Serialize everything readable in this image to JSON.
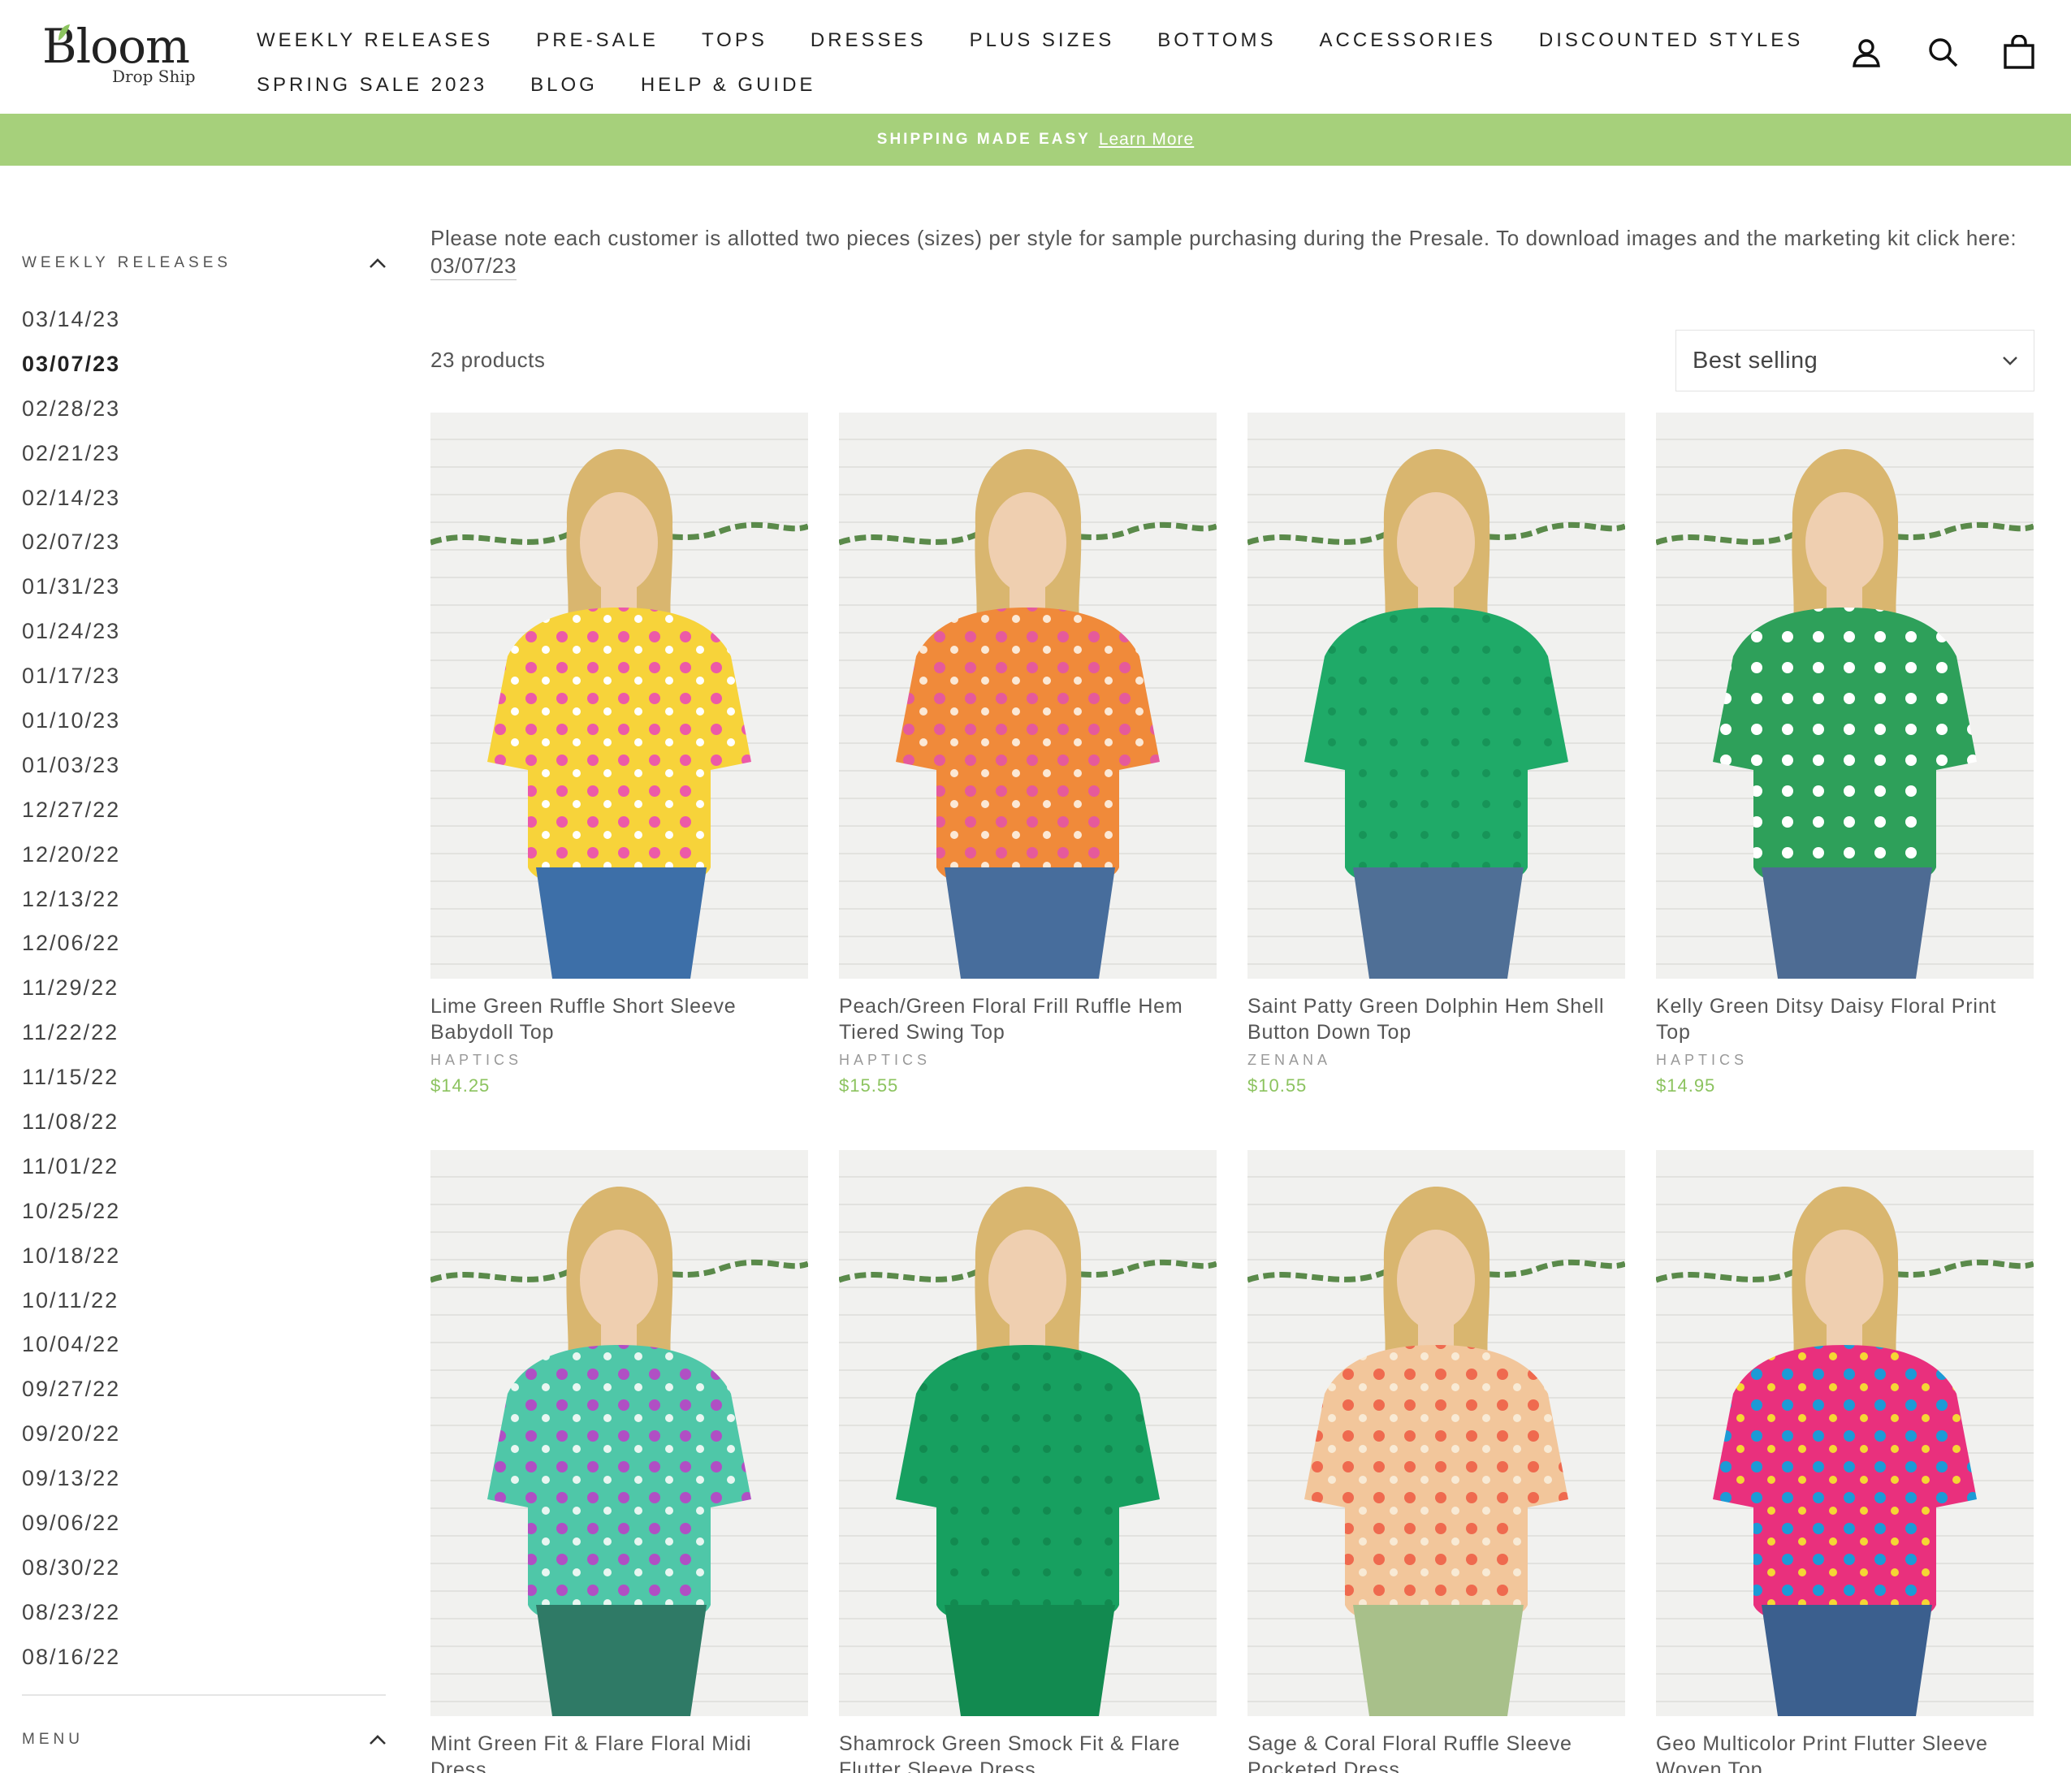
{
  "brand": {
    "name": "Bloom",
    "tagline": "Drop Ship"
  },
  "nav": {
    "row1": [
      "WEEKLY RELEASES",
      "PRE-SALE",
      "TOPS",
      "DRESSES",
      "PLUS SIZES",
      "BOTTOMS",
      "ACCESSORIES",
      "DISCOUNTED STYLES"
    ],
    "row2": [
      "SPRING SALE 2023",
      "BLOG",
      "HELP & GUIDE"
    ]
  },
  "header_icons": [
    "account-icon",
    "search-icon",
    "cart-icon"
  ],
  "announcement": {
    "text": "SHIPPING MADE EASY",
    "link": "Learn More"
  },
  "sidebar": {
    "section_label": "WEEKLY RELEASES",
    "dates": [
      "03/14/23",
      "03/07/23",
      "02/28/23",
      "02/21/23",
      "02/14/23",
      "02/07/23",
      "01/31/23",
      "01/24/23",
      "01/17/23",
      "01/10/23",
      "01/03/23",
      "12/27/22",
      "12/20/22",
      "12/13/22",
      "12/06/22",
      "11/29/22",
      "11/22/22",
      "11/15/22",
      "11/08/22",
      "11/01/22",
      "10/25/22",
      "10/18/22",
      "10/11/22",
      "10/04/22",
      "09/27/22",
      "09/20/22",
      "09/13/22",
      "09/06/22",
      "08/30/22",
      "08/23/22",
      "08/16/22"
    ],
    "active_date": "03/07/23",
    "menu_label": "MENU"
  },
  "main": {
    "note": "Please note each customer is allotted two pieces (sizes) per style for sample purchasing during the Presale. To download images and the marketing kit click here:",
    "note_link": "03/07/23",
    "product_count": "23 products",
    "sort_value": "Best selling"
  },
  "products": [
    {
      "title": "Lime Green Ruffle Short Sleeve Babydoll Top",
      "vendor": "HAPTICS",
      "price": "$14.25",
      "colors": [
        "#f7d33a",
        "#ec5aa8",
        "#ffffff",
        "#3d6fa8"
      ]
    },
    {
      "title": "Peach/Green Floral Frill Ruffle Hem Tiered Swing Top",
      "vendor": "HAPTICS",
      "price": "$15.55",
      "colors": [
        "#f08a3a",
        "#e55a9b",
        "#fbe8d5",
        "#476d9c"
      ]
    },
    {
      "title": "Saint Patty Green Dolphin Hem Shell Button Down Top",
      "vendor": "ZENANA",
      "price": "$10.55",
      "colors": [
        "#1faa68",
        "#1faa68",
        "#179458",
        "#4f6f96"
      ]
    },
    {
      "title": "Kelly Green Ditsy Daisy Floral Print Top",
      "vendor": "HAPTICS",
      "price": "$14.95",
      "colors": [
        "#2ea05a",
        "#ffffff",
        "#2ea05a",
        "#4d6b93"
      ]
    },
    {
      "title": "Mint Green Fit & Flare Floral Midi Dress",
      "vendor": "",
      "price": "",
      "colors": [
        "#4fc7a8",
        "#b04fc4",
        "#e8f6f1",
        "#2f7a66"
      ]
    },
    {
      "title": "Shamrock Green Smock Fit & Flare Flutter Sleeve Dress",
      "vendor": "",
      "price": "",
      "colors": [
        "#17a060",
        "#17a060",
        "#128a50",
        "#128a50"
      ]
    },
    {
      "title": "Sage & Coral Floral Ruffle Sleeve Pocketed Dress",
      "vendor": "",
      "price": "",
      "colors": [
        "#f2c69b",
        "#ef6a4f",
        "#f8ead5",
        "#a8c08a"
      ]
    },
    {
      "title": "Geo Multicolor Print Flutter Sleeve Woven Top",
      "vendor": "",
      "price": "",
      "colors": [
        "#e9307d",
        "#1c9ad6",
        "#f5d634",
        "#3b5f8e"
      ]
    }
  ]
}
